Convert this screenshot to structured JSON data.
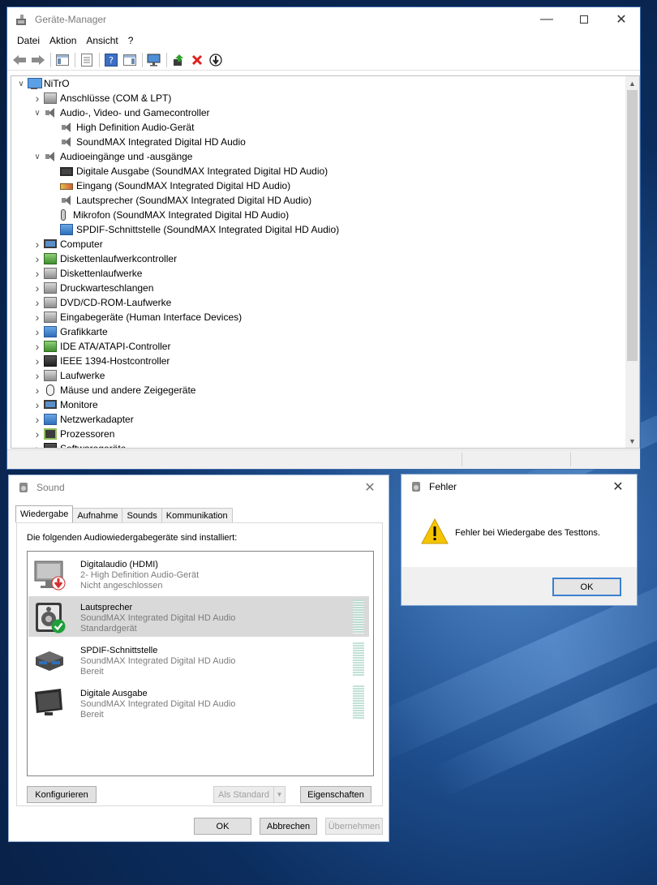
{
  "device_manager": {
    "title": "Geräte-Manager",
    "menu": [
      "Datei",
      "Aktion",
      "Ansicht",
      "?"
    ],
    "tree": [
      {
        "label": "NiTrO",
        "level": 0,
        "expand": "open",
        "icon": "computer-icon"
      },
      {
        "label": "Anschlüsse (COM & LPT)",
        "level": 1,
        "expand": "closed",
        "icon": "port-icon"
      },
      {
        "label": "Audio-, Video- und Gamecontroller",
        "level": 1,
        "expand": "open",
        "icon": "speaker-icon"
      },
      {
        "label": "High Definition Audio-Gerät",
        "level": 2,
        "expand": "none",
        "icon": "speaker-icon"
      },
      {
        "label": "SoundMAX Integrated Digital HD Audio",
        "level": 2,
        "expand": "none",
        "icon": "speaker-icon"
      },
      {
        "label": "Audioeingänge und -ausgänge",
        "level": 1,
        "expand": "open",
        "icon": "speaker-icon"
      },
      {
        "label": "Digitale Ausgabe (SoundMAX Integrated Digital HD Audio)",
        "level": 2,
        "expand": "none",
        "icon": "digital-output-icon"
      },
      {
        "label": "Eingang (SoundMAX Integrated Digital HD Audio)",
        "level": 2,
        "expand": "none",
        "icon": "line-in-icon"
      },
      {
        "label": "Lautsprecher (SoundMAX Integrated Digital HD Audio)",
        "level": 2,
        "expand": "none",
        "icon": "speaker-icon"
      },
      {
        "label": "Mikrofon (SoundMAX Integrated Digital HD Audio)",
        "level": 2,
        "expand": "none",
        "icon": "microphone-icon"
      },
      {
        "label": "SPDIF-Schnittstelle (SoundMAX Integrated Digital HD Audio)",
        "level": 2,
        "expand": "none",
        "icon": "spdif-icon"
      },
      {
        "label": "Computer",
        "level": 1,
        "expand": "closed",
        "icon": "monitor-icon"
      },
      {
        "label": "Diskettenlaufwerkcontroller",
        "level": 1,
        "expand": "closed",
        "icon": "floppy-controller-icon"
      },
      {
        "label": "Diskettenlaufwerke",
        "level": 1,
        "expand": "closed",
        "icon": "floppy-drive-icon"
      },
      {
        "label": "Druckwarteschlangen",
        "level": 1,
        "expand": "closed",
        "icon": "printer-icon"
      },
      {
        "label": "DVD/CD-ROM-Laufwerke",
        "level": 1,
        "expand": "closed",
        "icon": "dvd-icon"
      },
      {
        "label": "Eingabegeräte (Human Interface Devices)",
        "level": 1,
        "expand": "closed",
        "icon": "hid-icon"
      },
      {
        "label": "Grafikkarte",
        "level": 1,
        "expand": "closed",
        "icon": "display-adapter-icon"
      },
      {
        "label": "IDE ATA/ATAPI-Controller",
        "level": 1,
        "expand": "closed",
        "icon": "ide-icon"
      },
      {
        "label": "IEEE 1394-Hostcontroller",
        "level": 1,
        "expand": "closed",
        "icon": "firewire-icon"
      },
      {
        "label": "Laufwerke",
        "level": 1,
        "expand": "closed",
        "icon": "disk-drive-icon"
      },
      {
        "label": "Mäuse und andere Zeigegeräte",
        "level": 1,
        "expand": "closed",
        "icon": "mouse-icon"
      },
      {
        "label": "Monitore",
        "level": 1,
        "expand": "closed",
        "icon": "monitor-icon"
      },
      {
        "label": "Netzwerkadapter",
        "level": 1,
        "expand": "closed",
        "icon": "network-icon"
      },
      {
        "label": "Prozessoren",
        "level": 1,
        "expand": "closed",
        "icon": "processor-icon"
      },
      {
        "label": "Softwaregeräte",
        "level": 1,
        "expand": "closed",
        "icon": "software-device-icon"
      }
    ]
  },
  "sound": {
    "title": "Sound",
    "tabs": [
      "Wiedergabe",
      "Aufnahme",
      "Sounds",
      "Kommunikation"
    ],
    "section_label": "Die folgenden Audiowiedergabegeräte sind installiert:",
    "devices": [
      {
        "name": "Digitalaudio (HDMI)",
        "sub": "2- High Definition Audio-Gerät",
        "status": "Nicht angeschlossen",
        "selected": false,
        "badge": "red-down-arrow"
      },
      {
        "name": "Lautsprecher",
        "sub": "SoundMAX Integrated Digital HD Audio",
        "status": "Standardgerät",
        "selected": true,
        "badge": "green-check"
      },
      {
        "name": "SPDIF-Schnittstelle",
        "sub": "SoundMAX Integrated Digital HD Audio",
        "status": "Bereit",
        "selected": false,
        "badge": ""
      },
      {
        "name": "Digitale Ausgabe",
        "sub": "SoundMAX Integrated Digital HD Audio",
        "status": "Bereit",
        "selected": false,
        "badge": ""
      }
    ],
    "buttons": {
      "configure": "Konfigurieren",
      "set_default": "Als Standard",
      "properties": "Eigenschaften",
      "ok": "OK",
      "cancel": "Abbrechen",
      "apply": "Übernehmen"
    }
  },
  "error": {
    "title": "Fehler",
    "message": "Fehler bei Wiedergabe des Testtons.",
    "ok": "OK"
  },
  "colors": {
    "accent": "#3c7fd1",
    "warning": "#f5c400",
    "success": "#1f9e3a",
    "error": "#d32f2f"
  }
}
